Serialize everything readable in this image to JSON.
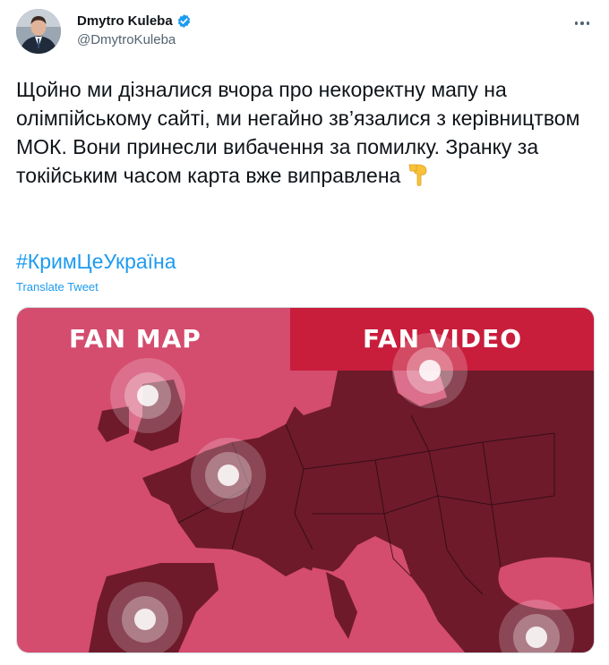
{
  "author": {
    "name": "Dmytro Kuleba",
    "handle": "@DmytroKuleba",
    "verified": true
  },
  "tweet": {
    "text": "Щойно ми дізналися вчора про некоректну мапу на олімпійському сайті, ми негайно зв’язалися з керівництвом МОК. Вони принесли вибачення за помилку. Зранку за токійським часом карта вже виправлена",
    "emoji": "backhand-index-pointing-down",
    "hashtag": "#КримЦеУкраїна",
    "translate_label": "Translate Tweet"
  },
  "media": {
    "tab_map": "FAN MAP",
    "tab_video": "FAN VIDEO"
  },
  "colors": {
    "link": "#1d9bf0",
    "secondary_text": "#536471",
    "map_sea": "#d44c6e",
    "map_land": "#6e1a2b",
    "map_tab_active": "#c91d3c"
  }
}
